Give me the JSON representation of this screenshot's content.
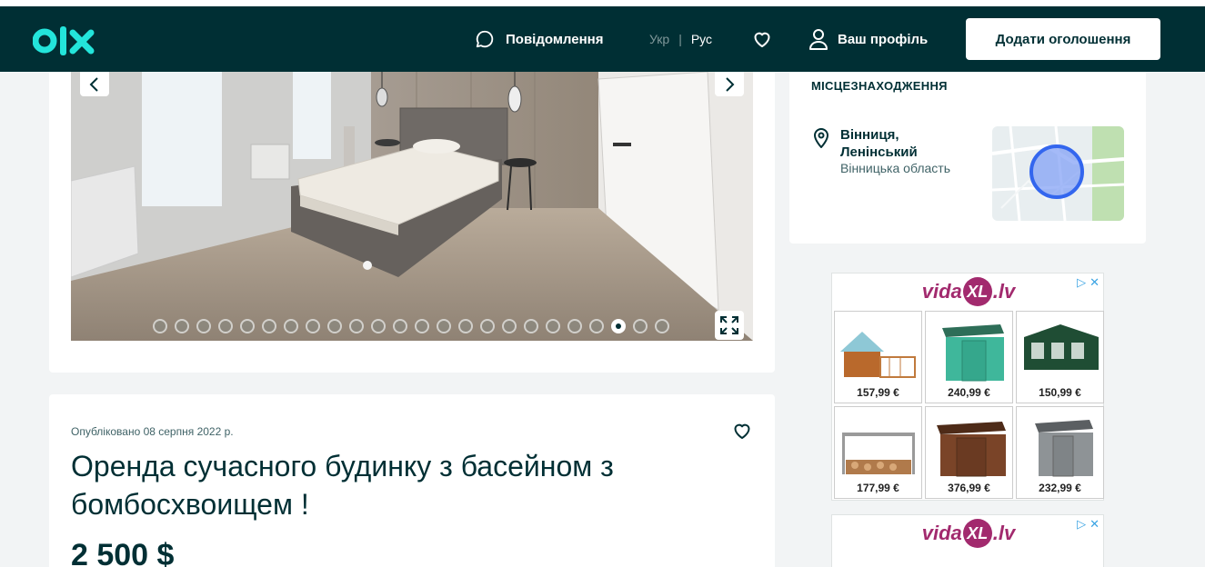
{
  "header": {
    "messages_label": "Повідомлення",
    "lang_ukr": "Укр",
    "lang_sep": "|",
    "lang_rus": "Рус",
    "profile_label": "Ваш профіль",
    "add_button": "Додати оголошення",
    "brand_colors": {
      "background": "#002f34",
      "accent": "#23e5db"
    }
  },
  "gallery": {
    "photo_count": 24,
    "active_index": 21
  },
  "listing": {
    "published": "Опубліковано 08 серпня 2022 р.",
    "title": "Оренда сучасного будинку з басейном з бомбосхвоищем !",
    "price": "2 500 $"
  },
  "location": {
    "heading": "МІСЦЕЗНАХОДЖЕННЯ",
    "city_line1": "Вінниця,",
    "city_line2": "Ленінський",
    "region": "Вінницька область"
  },
  "ads": {
    "brand": "vida",
    "brand_xl": "XL",
    "brand_tld": ".lv",
    "products": [
      {
        "name": "chicken-coop",
        "price": "157,99 €"
      },
      {
        "name": "green-metal-shed",
        "price": "240,99 €"
      },
      {
        "name": "party-tent",
        "price": "150,99 €"
      },
      {
        "name": "log-store",
        "price": "177,99 €"
      },
      {
        "name": "brown-metal-shed",
        "price": "376,99 €"
      },
      {
        "name": "grey-metal-shed",
        "price": "232,99 €"
      }
    ]
  },
  "icons": {
    "messages": "chat-bubble-icon",
    "favorite": "heart-icon",
    "profile": "user-icon",
    "location": "map-pin-icon",
    "expand": "fullscreen-icon"
  }
}
